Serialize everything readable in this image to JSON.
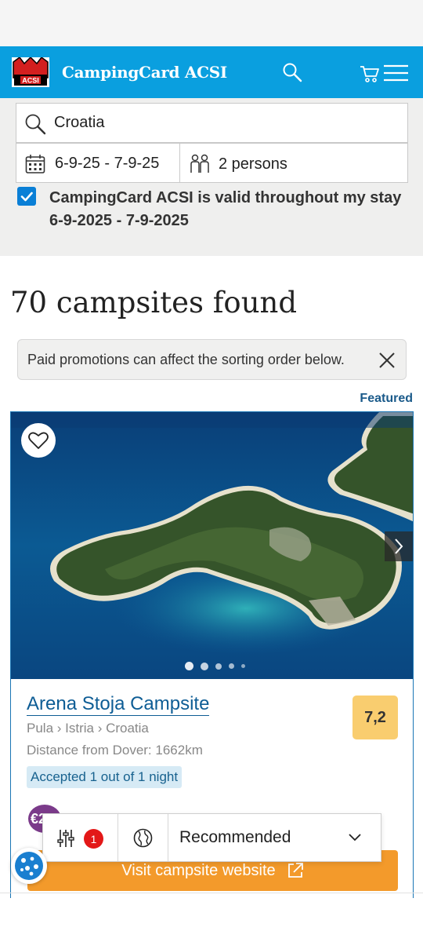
{
  "header": {
    "logo_text": "ACSI",
    "brand": "CampingCard ACSI"
  },
  "search": {
    "destination": "Croatia",
    "dates": "6-9-25 - 7-9-25",
    "persons": "2 persons",
    "valid_checkbox_line1": "CampingCard ACSI is valid throughout my stay",
    "valid_checkbox_line2": "6-9-2025 - 7-9-2025",
    "valid_checked": true
  },
  "results": {
    "title": "70 campsites found",
    "promo_notice": "Paid promotions can affect the sorting order below.",
    "featured_label": "Featured"
  },
  "card": {
    "name": "Arena Stoja Campsite",
    "breadcrumb": "Pula › Istria › Croatia",
    "distance": "Distance from Dover: 1662km",
    "accepted": "Accepted 1 out of 1 night",
    "score": "7,2",
    "badge": "€29",
    "visit_button": "Visit campsite website",
    "photo_dots": 5,
    "active_dot": 0
  },
  "toolbar": {
    "filter_count": "1",
    "sort": "Recommended"
  },
  "colors": {
    "header_blue": "#0a9fdf",
    "link_blue": "#0e5d95",
    "score_yellow": "#f9cd6f",
    "visit_orange": "#f39a2b",
    "badge_purple": "#7b3b8a"
  }
}
